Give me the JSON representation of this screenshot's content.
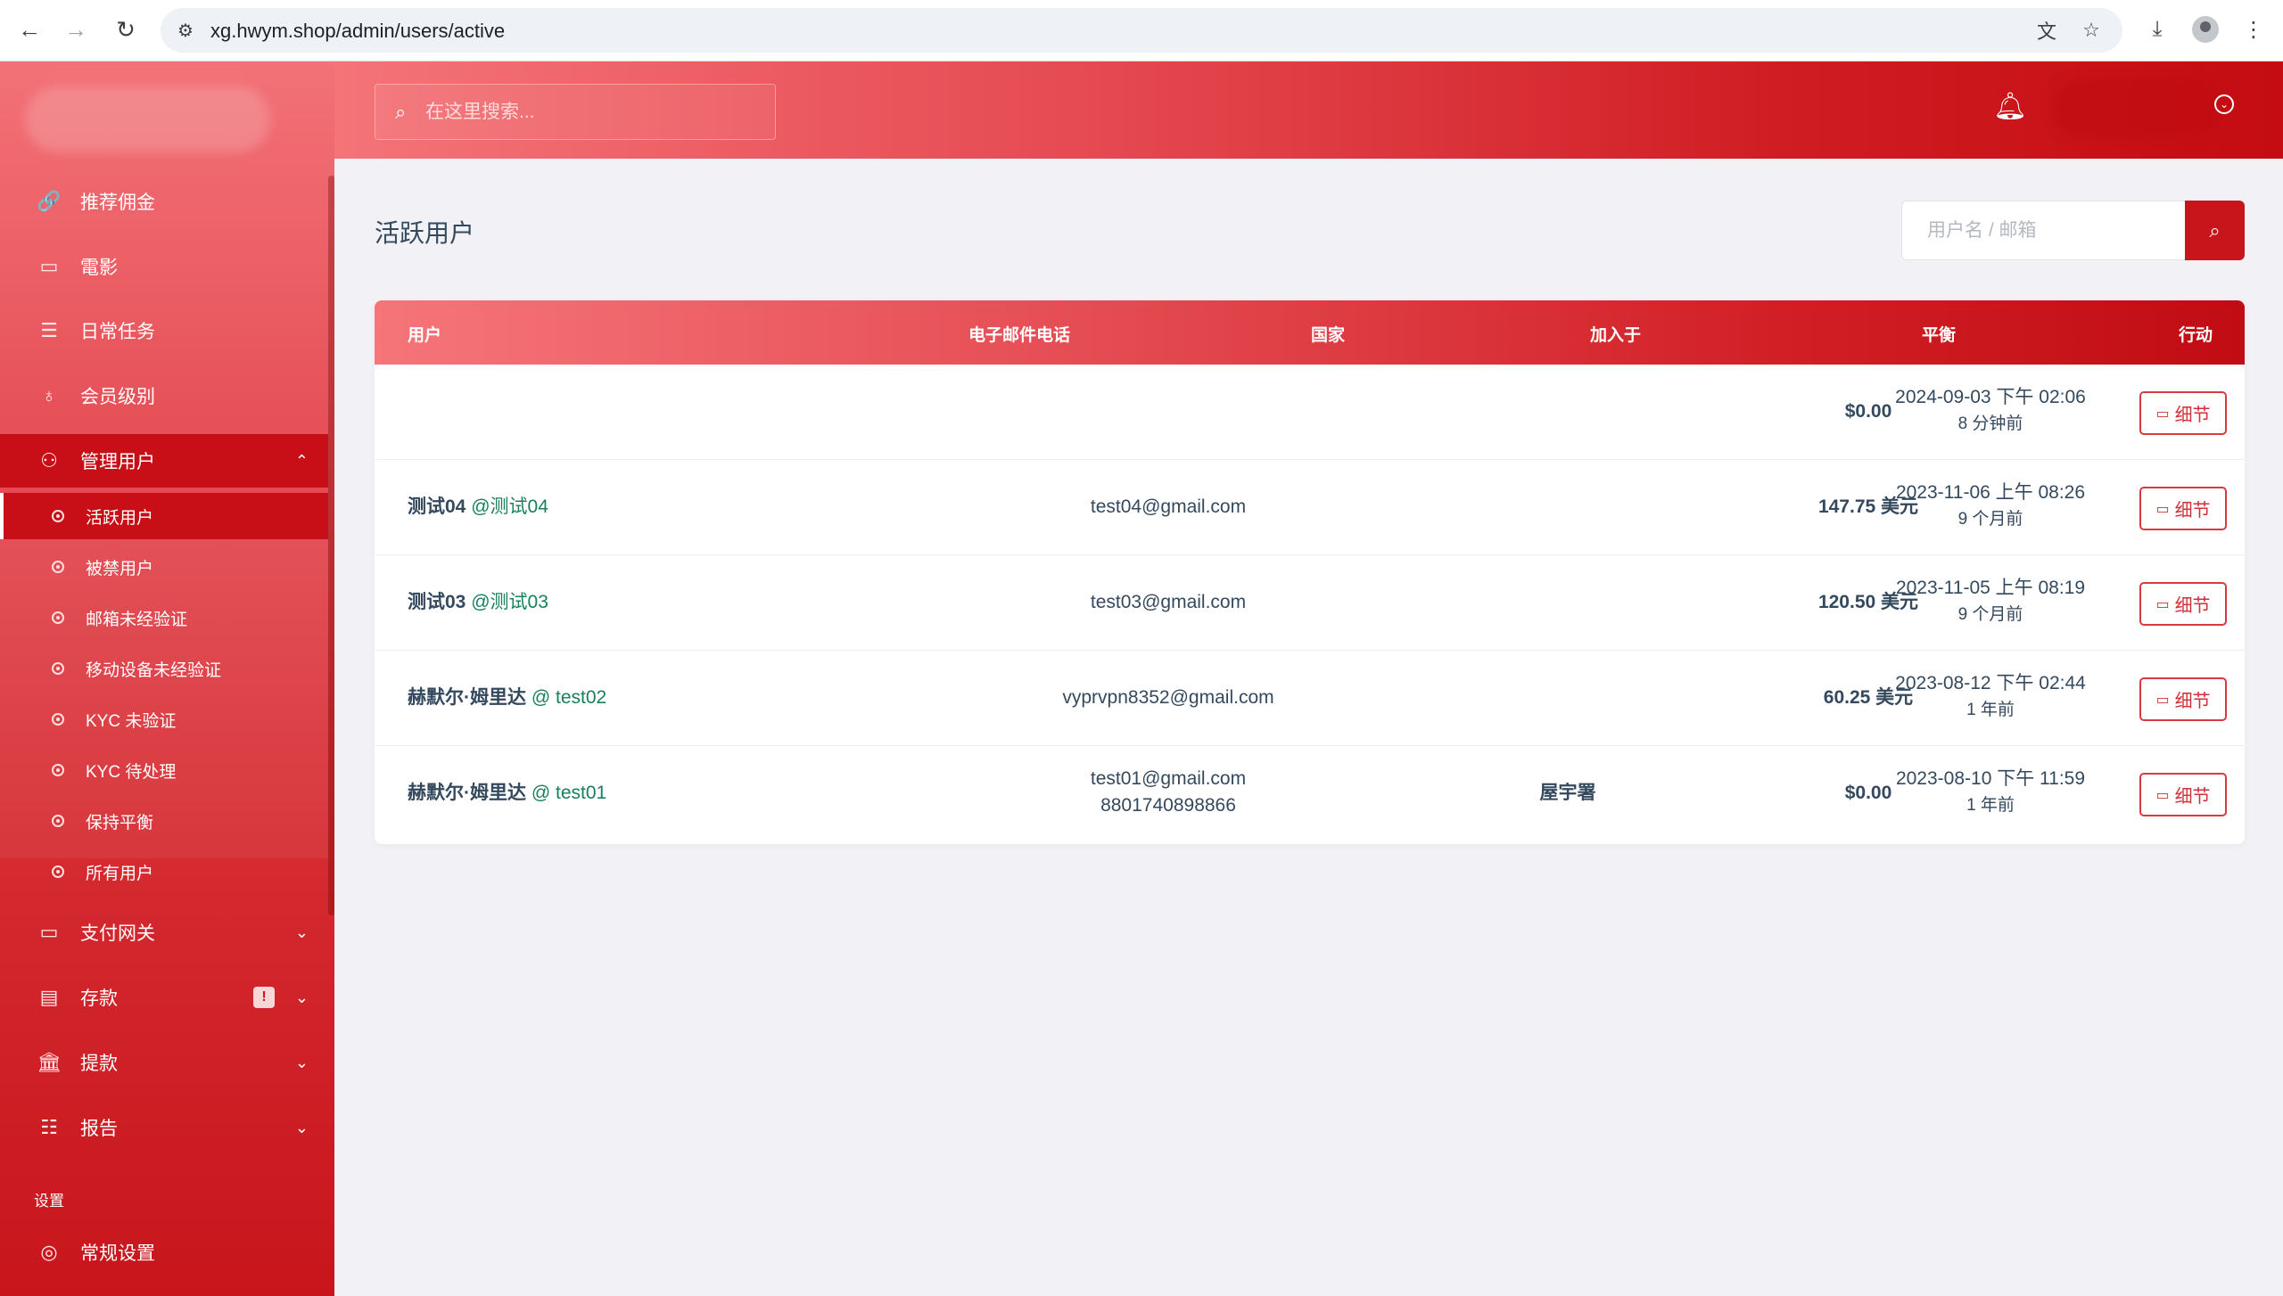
{
  "browser": {
    "url": "xg.hwym.shop/admin/users/active",
    "back_icon": "←",
    "forward_icon": "→",
    "reload_icon": "↻"
  },
  "header": {
    "search_placeholder": "在这里搜索..."
  },
  "sidebar": {
    "items": [
      {
        "label": "推荐佣金",
        "icon": "link-icon"
      },
      {
        "label": "電影",
        "icon": "film-icon"
      },
      {
        "label": "日常任务",
        "icon": "list-icon"
      },
      {
        "label": "会员级别",
        "icon": "award-icon"
      },
      {
        "label": "管理用户",
        "icon": "users-icon"
      }
    ],
    "submenu": [
      {
        "label": "活跃用户"
      },
      {
        "label": "被禁用户"
      },
      {
        "label": "邮箱未经验证"
      },
      {
        "label": "移动设备未经验证"
      },
      {
        "label": "KYC 未验证"
      },
      {
        "label": "KYC 待处理"
      },
      {
        "label": "保持平衡"
      },
      {
        "label": "所有用户"
      }
    ],
    "lower_items": [
      {
        "label": "支付网关",
        "icon": "credit-card-icon"
      },
      {
        "label": "存款",
        "icon": "receipt-icon",
        "badge": "!"
      },
      {
        "label": "提款",
        "icon": "bank-icon"
      },
      {
        "label": "报告",
        "icon": "report-list-icon"
      }
    ],
    "section_title": "设置",
    "settings_item": {
      "label": "常规设置",
      "icon": "settings-icon"
    }
  },
  "main": {
    "title": "活跃用户",
    "filter_placeholder": "用户名 / 邮箱",
    "columns": [
      "用户",
      "电子邮件电话",
      "国家",
      "加入于",
      "平衡",
      "行动"
    ],
    "detail_label": "细节",
    "rows": [
      {
        "name": "",
        "handle": "",
        "email": "",
        "phone": "",
        "country": "",
        "joined": "2024-09-03 下午 02:06",
        "ago": "8 分钟前",
        "balance": "$0.00"
      },
      {
        "name": "测试04",
        "handle": "@测试04",
        "email": "test04@gmail.com",
        "phone": "",
        "country": "",
        "joined": "2023-11-06 上午 08:26",
        "ago": "9 个月前",
        "balance": "147.75 美元"
      },
      {
        "name": "测试03",
        "handle": "@测试03",
        "email": "test03@gmail.com",
        "phone": "",
        "country": "",
        "joined": "2023-11-05 上午 08:19",
        "ago": "9 个月前",
        "balance": "120.50 美元"
      },
      {
        "name": "赫默尔·姆里达",
        "handle": "@ test02",
        "email": "vyprvpn8352@gmail.com",
        "phone": "",
        "country": "",
        "joined": "2023-08-12 下午 02:44",
        "ago": "1 年前",
        "balance": "60.25 美元"
      },
      {
        "name": "赫默尔·姆里达",
        "handle": "@ test01",
        "email": "test01@gmail.com",
        "phone": "8801740898866",
        "country": "屋宇署",
        "joined": "2023-08-10 下午 11:59",
        "ago": "1 年前",
        "balance": "$0.00"
      }
    ]
  },
  "colors": {
    "brand": "#c8151c",
    "accent_light": "#f57579",
    "handle_green": "#18805a"
  }
}
